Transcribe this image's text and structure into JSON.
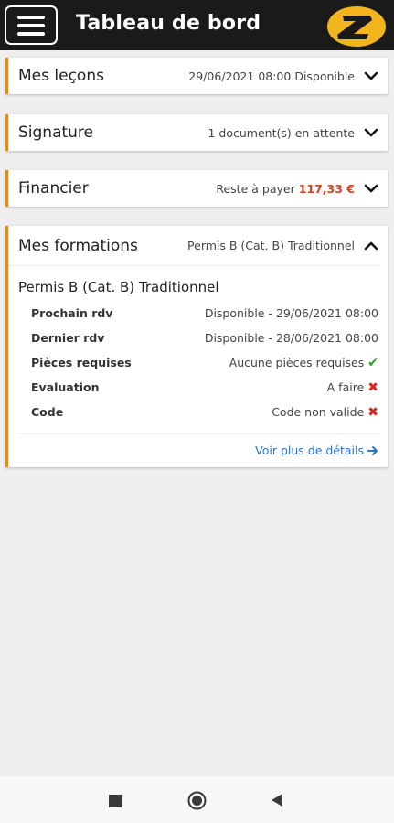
{
  "appbar": {
    "title": "Tableau de bord",
    "menu_icon": "hamburger-menu-icon",
    "logo_letter": "Z",
    "colors": {
      "background": "#1a1a1a",
      "logo": "#f2b61c"
    }
  },
  "cards": {
    "lecons": {
      "title": "Mes leçons",
      "summary": "29/06/2021 08:00 Disponible",
      "icon": "chevron-down-icon"
    },
    "signature": {
      "title": "Signature",
      "summary": "1 document(s) en attente",
      "icon": "chevron-down-icon"
    },
    "financier": {
      "title": "Financier",
      "summary_prefix": "Reste à payer",
      "amount": "117,33 €",
      "icon": "chevron-down-icon"
    },
    "formations": {
      "title": "Mes formations",
      "summary": "Permis B (Cat. B) Traditionnel",
      "icon": "chevron-up-icon",
      "formation_title": "Permis B (Cat. B) Traditionnel",
      "rows": [
        {
          "label": "Prochain rdv",
          "value": "Disponible - 29/06/2021 08:00",
          "status": ""
        },
        {
          "label": "Dernier rdv",
          "value": "Disponible - 28/06/2021 08:00",
          "status": ""
        },
        {
          "label": "Pièces requises",
          "value": "Aucune pièces requises",
          "status": "ok"
        },
        {
          "label": "Evaluation",
          "value": "A faire",
          "status": "ko"
        },
        {
          "label": "Code",
          "value": "Code non valide",
          "status": "ko"
        }
      ],
      "details_link": "Voir plus de détails",
      "details_icon": "arrow-right-icon"
    }
  },
  "colors": {
    "accent": "#e08a1e",
    "amount": "#d9441f",
    "link": "#2a73c9",
    "ok": "#2e9e2e",
    "ko": "#d9251f"
  },
  "navbar": {
    "icons": [
      "recent-apps-icon",
      "home-icon",
      "back-icon"
    ]
  }
}
